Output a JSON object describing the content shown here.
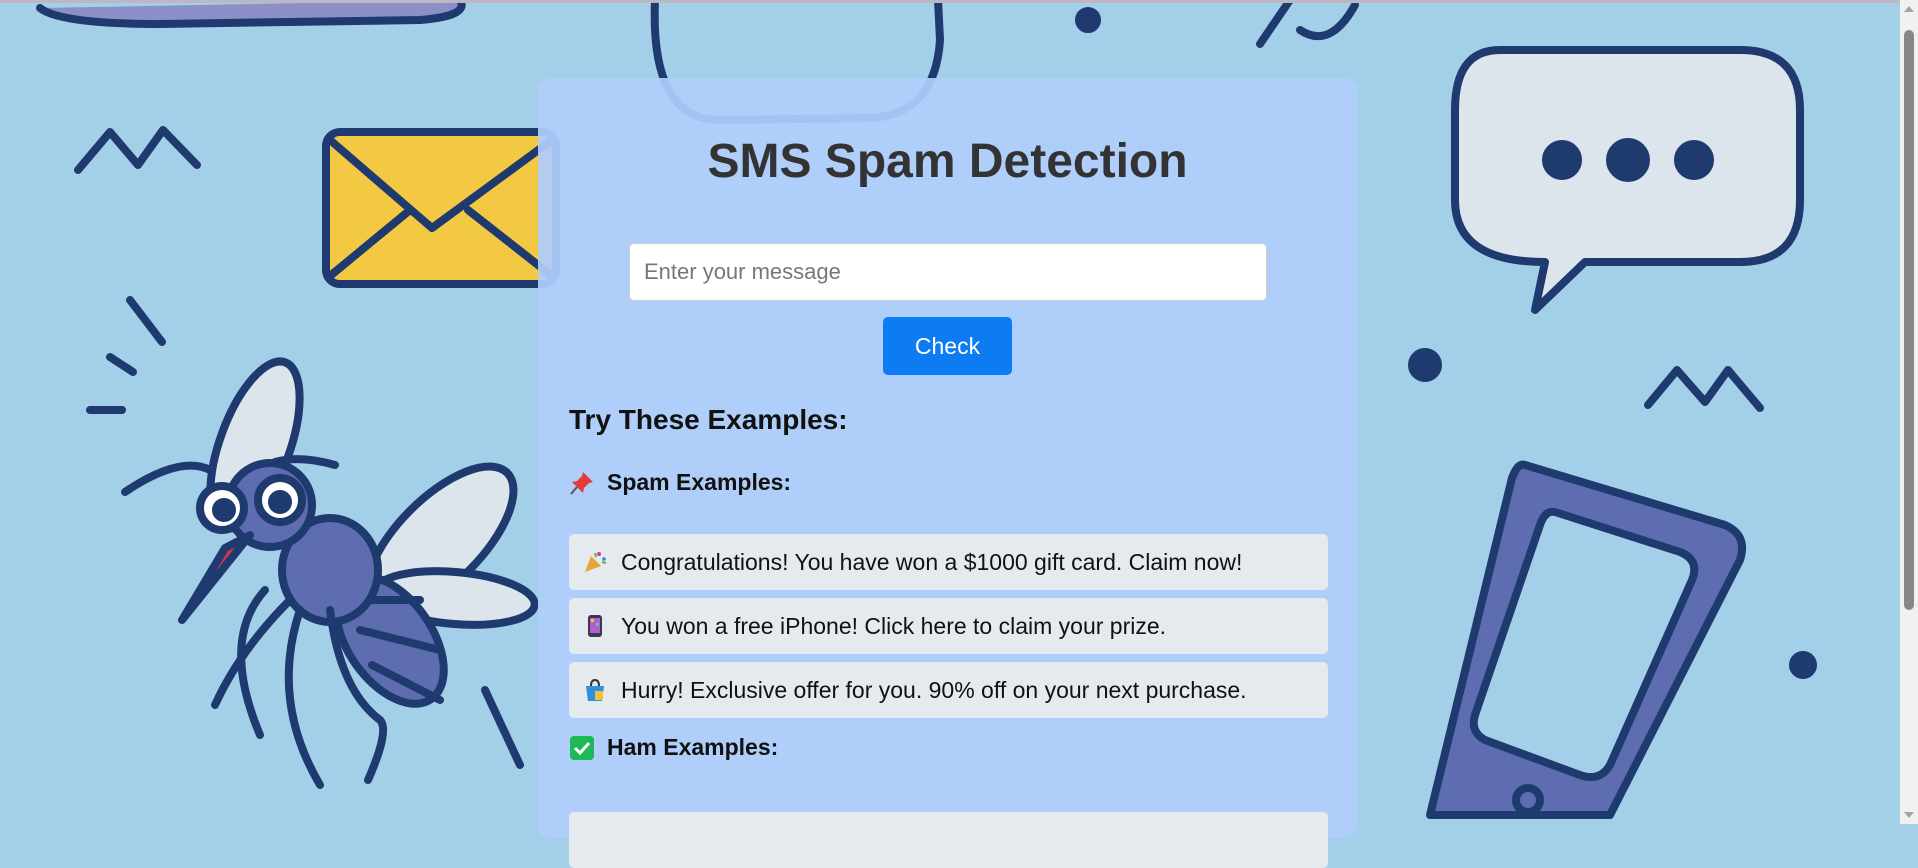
{
  "page": {
    "title": "SMS Spam Detection"
  },
  "form": {
    "placeholder": "Enter your message",
    "check_label": "Check"
  },
  "examples": {
    "heading": "Try These Examples:",
    "spam": {
      "heading": "Spam Examples:",
      "icon": "pushpin-icon",
      "items": [
        {
          "text": "Congratulations! You have won a $1000 gift card. Claim now!",
          "icon": "party-popper-icon"
        },
        {
          "text": "You won a free iPhone! Click here to claim your prize.",
          "icon": "mobile-phone-icon"
        },
        {
          "text": "Hurry! Exclusive offer for you. 90% off on your next purchase.",
          "icon": "shopping-bag-icon"
        }
      ]
    },
    "ham": {
      "heading": "Ham Examples:",
      "icon": "check-mark-icon"
    }
  },
  "colors": {
    "background": "#a3cfe9",
    "card": "#afcdfa",
    "button": "#0d7cf2",
    "example_bg": "#e5eaee",
    "title": "#333333"
  },
  "scroll": {
    "position": 0
  }
}
